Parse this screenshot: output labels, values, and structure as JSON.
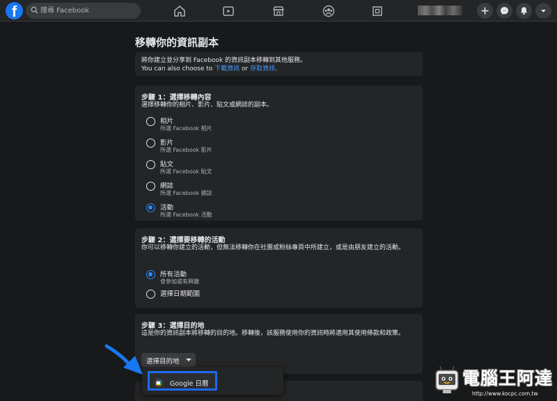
{
  "topbar": {
    "search_placeholder": "搜尋 Facebook",
    "nav_icons": [
      "home-icon",
      "watch-icon",
      "marketplace-icon",
      "groups-icon",
      "gaming-icon"
    ],
    "action_icons": [
      "plus-icon",
      "messenger-icon",
      "bell-icon",
      "chevron-down-icon"
    ]
  },
  "main": {
    "title": "移轉你的資訊副本",
    "intro": {
      "line1": "將你建立並分享到 Facebook 的資訊副本移轉到其他服務。",
      "line2_prefix": "You can also choose to ",
      "link_download": "下載資訊",
      "line2_mid": " or ",
      "link_access": "存取資訊",
      "line2_suffix": "."
    },
    "step1": {
      "title": "步驟 1：選擇移轉內容",
      "desc": "選擇移轉你的相片、影片、貼文或網誌的副本。",
      "options": [
        {
          "label": "相片",
          "sub": "所選 Facebook 相片",
          "checked": false
        },
        {
          "label": "影片",
          "sub": "所選 Facebook 影片",
          "checked": false
        },
        {
          "label": "貼文",
          "sub": "所選 Facebook 貼文",
          "checked": false
        },
        {
          "label": "網誌",
          "sub": "所選 Facebook 網誌",
          "checked": false
        },
        {
          "label": "活動",
          "sub": "所選 Facebook 活動",
          "checked": true
        }
      ]
    },
    "step2": {
      "title": "步驟 2：選擇要移轉的活動",
      "desc": "你可以移轉你建立的活動，但無法移轉你在社團或粉絲專頁中所建立，或是由朋友建立的活動。",
      "options": [
        {
          "label": "所有活動",
          "sub": "會參加或有興趣",
          "checked": true
        },
        {
          "label": "選擇日期範圍",
          "sub": "",
          "checked": false
        }
      ]
    },
    "step3": {
      "title": "步驟 3：選擇目的地",
      "desc": "這是你的資訊副本將移轉的目的地。移轉後，該服務使用你的資訊時將適用其使用條款和政策。",
      "select_label": "選擇目的地"
    },
    "dropdown": {
      "items": [
        {
          "label": "Google 日曆",
          "icon": "google-calendar-icon"
        }
      ]
    }
  },
  "watermark": {
    "title": "電腦王阿達",
    "url": "http://www.kocpc.com.tw"
  },
  "colors": {
    "background": "#18191a",
    "card": "#242526",
    "accent": "#2d88ff",
    "highlight_border": "#1d6bf2",
    "arrow": "#1877f2"
  }
}
